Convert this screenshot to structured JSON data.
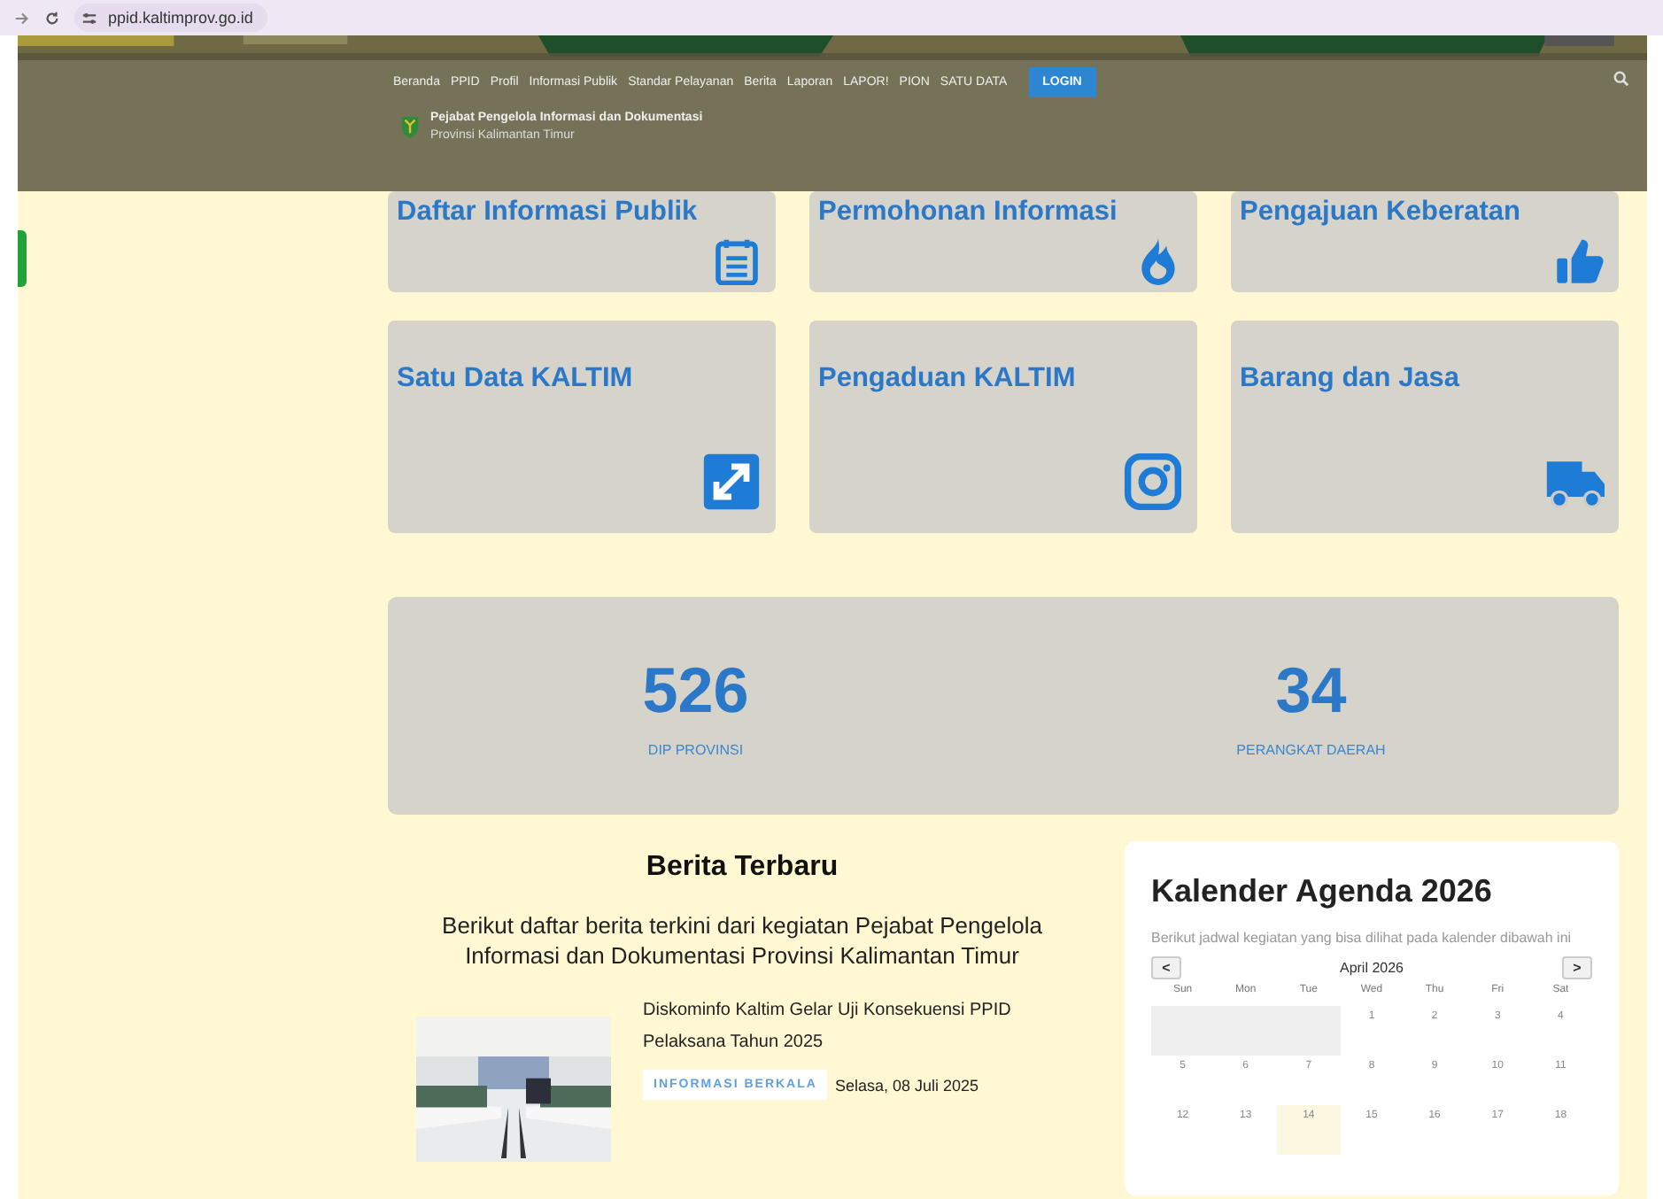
{
  "browser": {
    "url": "ppid.kaltimprov.go.id"
  },
  "header": {
    "org_name": "Pejabat Pengelola Informasi dan Dokumentasi",
    "org_region": "Provinsi Kalimantan Timur",
    "menu": [
      {
        "label": "Beranda"
      },
      {
        "label": "PPID"
      },
      {
        "label": "Profil"
      },
      {
        "label": "Informasi Publik"
      },
      {
        "label": "Standar Pelayanan"
      },
      {
        "label": "Berita"
      },
      {
        "label": "Laporan"
      },
      {
        "label": "LAPOR!"
      },
      {
        "label": "PION"
      },
      {
        "label": "SATU DATA"
      }
    ],
    "login": "LOGIN"
  },
  "cards": [
    {
      "title": "Daftar Informasi Publik"
    },
    {
      "title": "Permohonan Informasi"
    },
    {
      "title": "Pengajuan Keberatan"
    },
    {
      "title": "Satu Data KALTIM"
    },
    {
      "title": "Pengaduan KALTIM"
    },
    {
      "title": "Barang dan Jasa"
    }
  ],
  "stats": [
    {
      "value": "526",
      "label": "DIP PROVINSI"
    },
    {
      "value": "34",
      "label": "PERANGKAT DAERAH"
    }
  ],
  "news": {
    "heading": "Berita Terbaru",
    "intro": "Berikut daftar berita terkini dari kegiatan Pejabat Pengelola Informasi dan Dokumentasi Provinsi Kalimantan Timur",
    "items": [
      {
        "kind": "picture",
        "title": "Diskominfo Kaltim Gelar Uji Konsekuensi PPID Pelaksana Tahun 2025",
        "tag": "INFORMASI BERKALA",
        "date": "Selasa, 08 Juli 2025"
      }
    ]
  },
  "calendar": {
    "title": "Kalender Agenda 2026",
    "description": "Berikut jadwal kegiatan yang bisa dilihat pada kalender dibawah ini",
    "month": "April 2026",
    "prev": "<",
    "next": ">",
    "weekdays": [
      "Sun",
      "Mon",
      "Tue",
      "Wed",
      "Thu",
      "Fri",
      "Sat"
    ],
    "weeks": [
      [
        {
          "kind": "blank"
        },
        {
          "kind": "blank"
        },
        {
          "kind": "blank"
        },
        {
          "kind": "day",
          "label": "1",
          "today": false
        },
        {
          "kind": "day",
          "label": "2",
          "today": false
        },
        {
          "kind": "day",
          "label": "3",
          "today": false
        },
        {
          "kind": "day",
          "label": "4",
          "today": false
        }
      ],
      [
        {
          "kind": "day",
          "label": "5",
          "today": false
        },
        {
          "kind": "day",
          "label": "6",
          "today": false
        },
        {
          "kind": "day",
          "label": "7",
          "today": false
        },
        {
          "kind": "day",
          "label": "8",
          "today": false
        },
        {
          "kind": "day",
          "label": "9",
          "today": false
        },
        {
          "kind": "day",
          "label": "10",
          "today": false
        },
        {
          "kind": "day",
          "label": "11",
          "today": false
        }
      ],
      [
        {
          "kind": "day",
          "label": "12",
          "today": false
        },
        {
          "kind": "day",
          "label": "13",
          "today": false
        },
        {
          "kind": "day",
          "label": "14",
          "today": true
        },
        {
          "kind": "day",
          "label": "15",
          "today": false
        },
        {
          "kind": "day",
          "label": "16",
          "today": false
        },
        {
          "kind": "day",
          "label": "17",
          "today": false
        },
        {
          "kind": "day",
          "label": "18",
          "today": false
        }
      ]
    ]
  }
}
